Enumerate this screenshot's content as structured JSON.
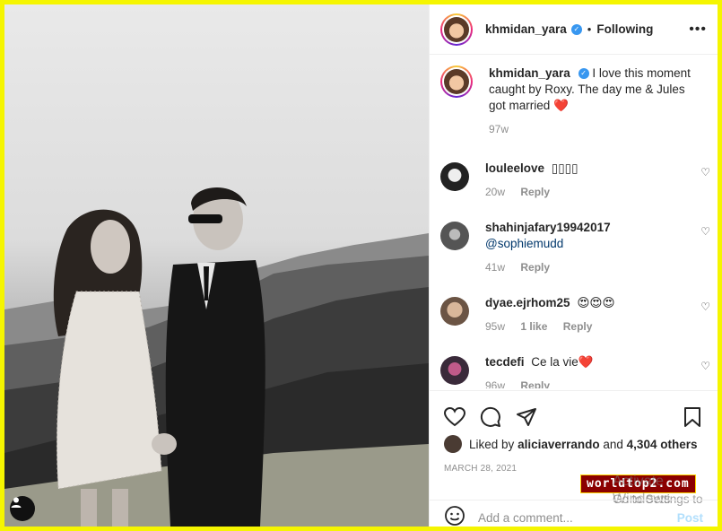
{
  "post": {
    "username": "khmidan_yara",
    "follow_status": "Following",
    "dot": "•",
    "more_icon": "more-dots-icon",
    "caption": "I love this moment caught by Roxy. The day me & Jules got married",
    "caption_emoji": "❤️",
    "caption_age": "97w"
  },
  "comments": [
    {
      "user": "louleelove",
      "text": "▯▯▯▯",
      "age": "20w",
      "likes": "",
      "reply": "Reply"
    },
    {
      "user": "shahinjafary19942017",
      "text": "@sophiemudd",
      "age": "41w",
      "likes": "",
      "reply": "Reply"
    },
    {
      "user": "dyae.ejrhom25",
      "text": "😍😍😍",
      "age": "95w",
      "likes": "1 like",
      "reply": "Reply"
    },
    {
      "user": "tecdefi",
      "text": "Ce la vie",
      "emoji": "❤️",
      "age": "96w",
      "likes": "",
      "reply": "Reply"
    }
  ],
  "likes": {
    "prefix": "Liked by",
    "user": "aliciaverrando",
    "middle": "and",
    "count": "4,304 others"
  },
  "date": "MARCH 28, 2021",
  "add_comment": {
    "placeholder": "Add a comment...",
    "post_label": "Post"
  },
  "overlay": {
    "watermark": "worldtop2.com",
    "activate_line1": "Activate Windows",
    "activate_line2": "Go to Settings to"
  },
  "colors": {
    "frame": "#f5f500",
    "verified": "#3897f0",
    "heart": "#ed4956",
    "post_disabled": "#b2dffc"
  }
}
